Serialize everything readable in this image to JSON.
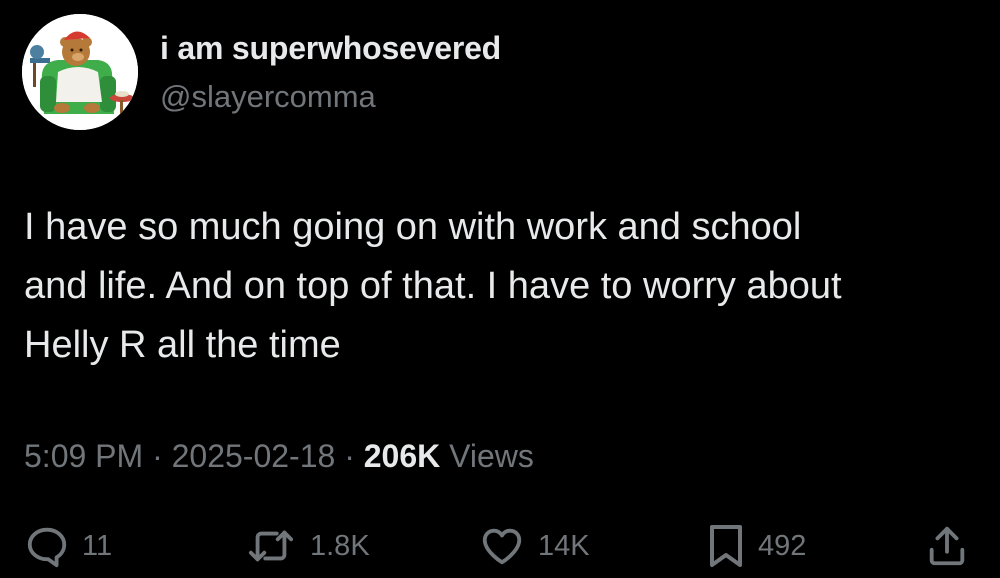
{
  "author": {
    "display_name": "i am superwhosevered",
    "handle": "@slayercomma",
    "avatar": "teddy-bear-in-armchair-avatar"
  },
  "tweet": {
    "text_lines": [
      "I have so much going on with work and school",
      "and life. And on top of that. I have to worry about",
      "Helly R all the time"
    ]
  },
  "meta": {
    "time": "5:09 PM",
    "separator": "·",
    "date": "2025-02-18",
    "views_count": "206K",
    "views_label": "Views"
  },
  "actions": {
    "reply": {
      "icon": "reply-icon",
      "count": "11"
    },
    "repost": {
      "icon": "repost-icon",
      "count": "1.8K"
    },
    "like": {
      "icon": "heart-icon",
      "count": "14K"
    },
    "bookmark": {
      "icon": "bookmark-icon",
      "count": "492"
    },
    "share": {
      "icon": "share-icon"
    }
  },
  "colors": {
    "background": "#000000",
    "primary_text": "#e7e9ea",
    "secondary_text": "#71767b"
  }
}
